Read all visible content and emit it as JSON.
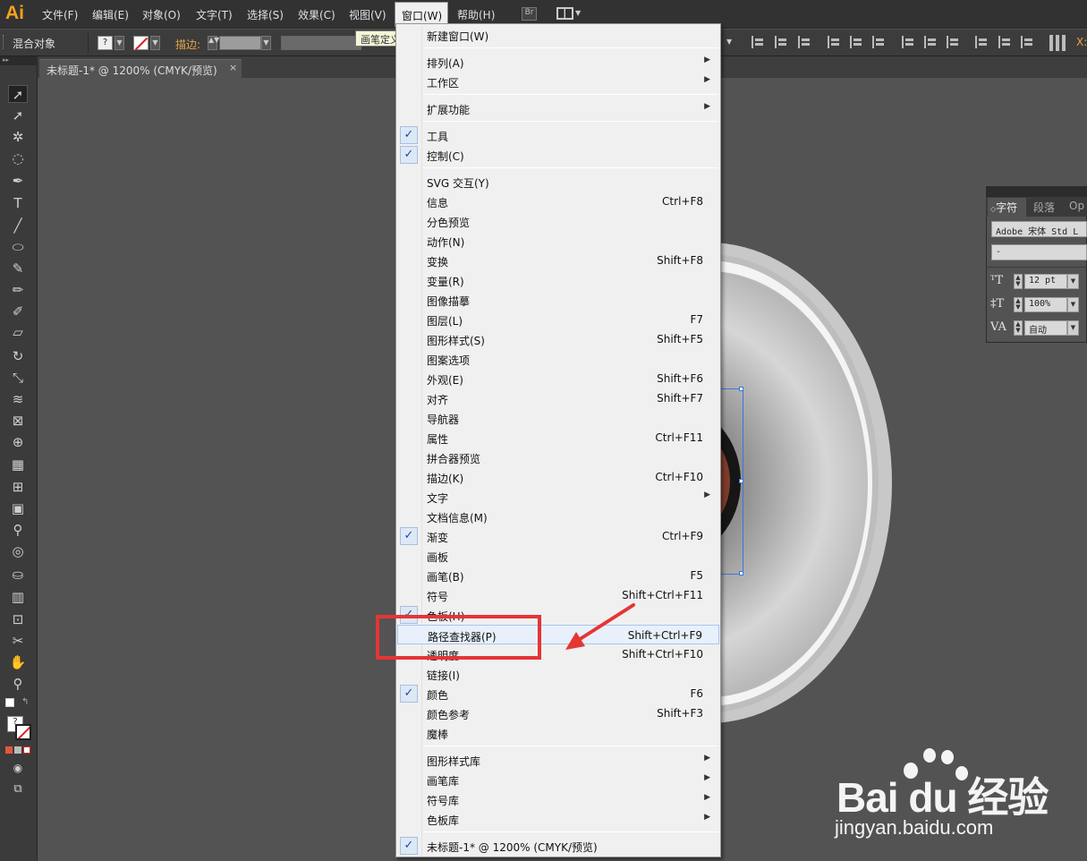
{
  "app": {
    "logo": "Ai"
  },
  "menubar": {
    "items": [
      "文件(F)",
      "编辑(E)",
      "对象(O)",
      "文字(T)",
      "选择(S)",
      "效果(C)",
      "视图(V)",
      "窗口(W)",
      "帮助(H)"
    ],
    "bridge_label": "Br"
  },
  "control": {
    "selection_label": "混合对象",
    "fill_value": "?",
    "stroke_label": "描边:",
    "tooltip": "画笔定义"
  },
  "document": {
    "tab_label": "未标题-1* @ 1200% (CMYK/预览)",
    "close": "×"
  },
  "window_menu": {
    "groups": [
      [
        {
          "label": "新建窗口(W)"
        }
      ],
      [
        {
          "label": "排列(A)",
          "submenu": true
        },
        {
          "label": "工作区",
          "submenu": true
        }
      ],
      [
        {
          "label": "扩展功能",
          "submenu": true
        }
      ],
      [
        {
          "label": "工具",
          "checked": true
        },
        {
          "label": "控制(C)",
          "checked": true
        }
      ],
      [
        {
          "label": "SVG 交互(Y)"
        },
        {
          "label": "信息",
          "shortcut": "Ctrl+F8"
        },
        {
          "label": "分色预览"
        },
        {
          "label": "动作(N)"
        },
        {
          "label": "变换",
          "shortcut": "Shift+F8"
        },
        {
          "label": "变量(R)"
        },
        {
          "label": "图像描摹"
        },
        {
          "label": "图层(L)",
          "shortcut": "F7"
        },
        {
          "label": "图形样式(S)",
          "shortcut": "Shift+F5"
        },
        {
          "label": "图案选项"
        },
        {
          "label": "外观(E)",
          "shortcut": "Shift+F6"
        },
        {
          "label": "对齐",
          "shortcut": "Shift+F7"
        },
        {
          "label": "导航器"
        },
        {
          "label": "属性",
          "shortcut": "Ctrl+F11"
        },
        {
          "label": "拼合器预览"
        },
        {
          "label": "描边(K)",
          "shortcut": "Ctrl+F10"
        },
        {
          "label": "文字",
          "submenu": true
        },
        {
          "label": "文档信息(M)"
        },
        {
          "label": "渐变",
          "shortcut": "Ctrl+F9",
          "checked": true
        },
        {
          "label": "画板"
        },
        {
          "label": "画笔(B)",
          "shortcut": "F5"
        },
        {
          "label": "符号",
          "shortcut": "Shift+Ctrl+F11"
        },
        {
          "label": "色板(H)",
          "checked": true
        },
        {
          "label": "路径查找器(P)",
          "shortcut": "Shift+Ctrl+F9",
          "highlighted": true
        },
        {
          "label": "透明度",
          "shortcut": "Shift+Ctrl+F10"
        },
        {
          "label": "链接(I)"
        },
        {
          "label": "颜色",
          "shortcut": "F6",
          "checked": true
        },
        {
          "label": "颜色参考",
          "shortcut": "Shift+F3"
        },
        {
          "label": "魔棒"
        }
      ],
      [
        {
          "label": "图形样式库",
          "submenu": true
        },
        {
          "label": "画笔库",
          "submenu": true
        },
        {
          "label": "符号库",
          "submenu": true
        },
        {
          "label": "色板库",
          "submenu": true
        }
      ],
      [
        {
          "label": "未标题-1* @ 1200% (CMYK/预览)",
          "checked": true
        }
      ]
    ]
  },
  "character_panel": {
    "tabs": [
      "字符",
      "段落",
      "Op"
    ],
    "font_family": "Adobe 宋体 Std L",
    "font_style": "-",
    "font_size": "12 pt",
    "leading": "100%",
    "tracking": "自动"
  },
  "watermark": {
    "brand": "Bai du 经验",
    "url": "jingyan.baidu.com"
  },
  "colors": {
    "accent_red": "#e53535",
    "ai_orange": "#f7a21b",
    "selection_blue": "#3c74e0"
  }
}
